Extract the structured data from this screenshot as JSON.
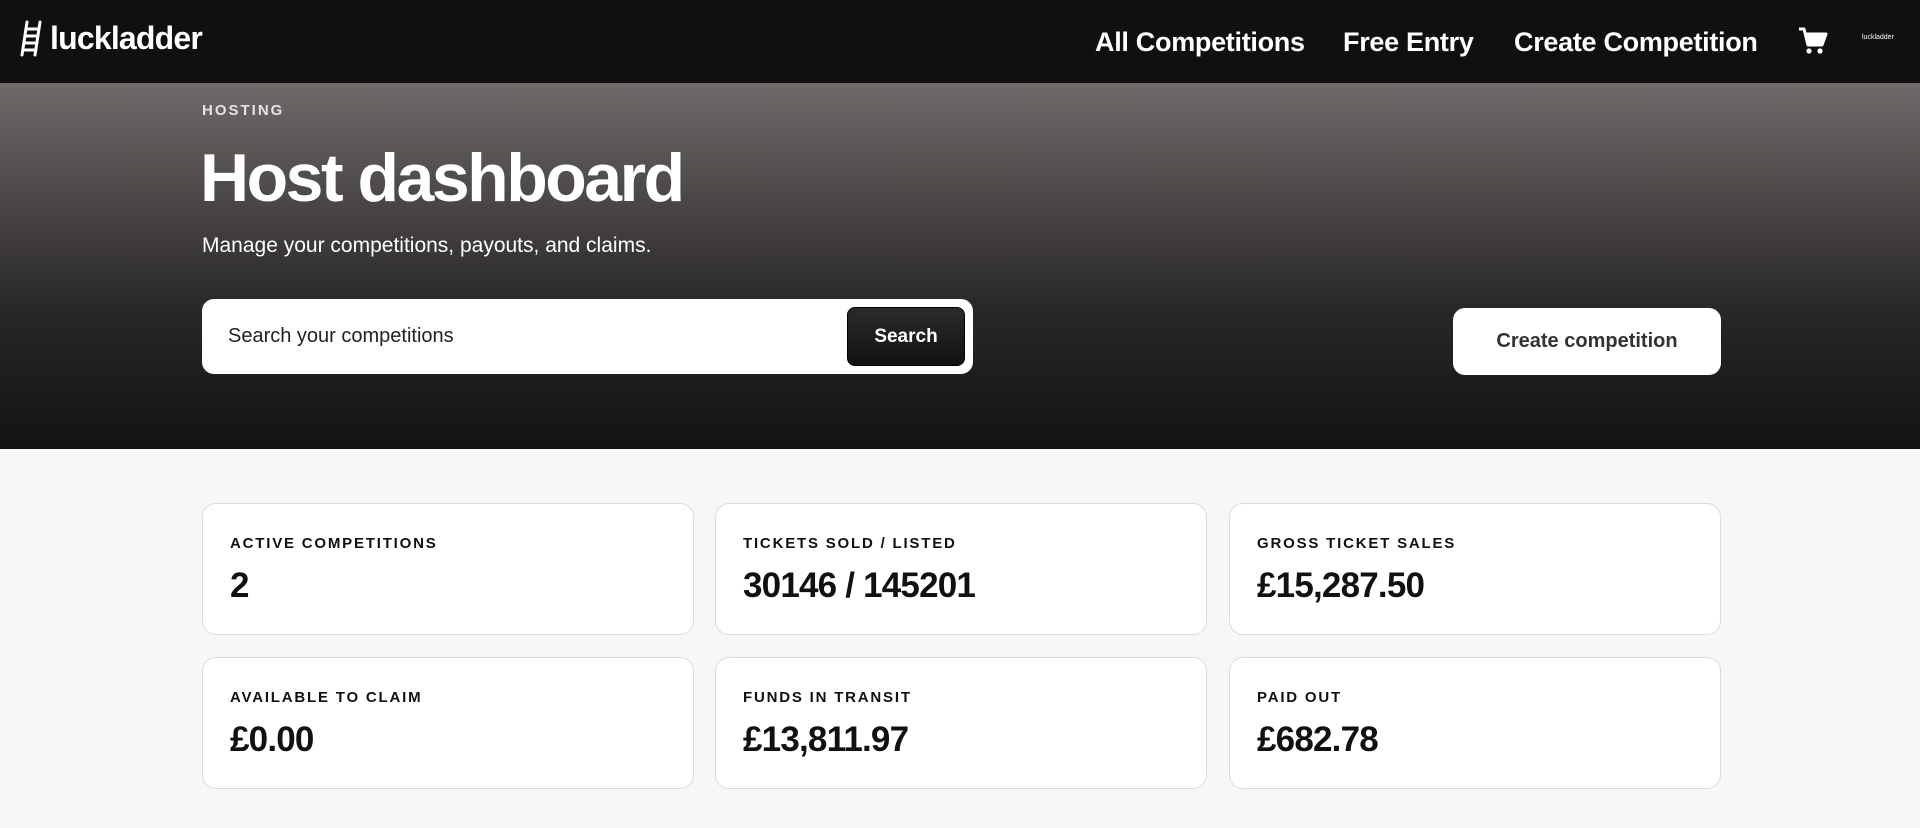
{
  "header": {
    "brand": "luckladder",
    "nav": [
      {
        "label": "All Competitions"
      },
      {
        "label": "Free Entry"
      },
      {
        "label": "Create Competition"
      }
    ],
    "cart_icon": "cart-icon",
    "mini_logo": "luckladder"
  },
  "hero": {
    "eyebrow": "HOSTING",
    "title": "Host dashboard",
    "subtitle": "Manage your competitions, payouts, and claims.",
    "search": {
      "placeholder": "Search your competitions",
      "value": "",
      "button_label": "Search"
    },
    "create_label": "Create competition"
  },
  "stats": [
    {
      "label": "ACTIVE COMPETITIONS",
      "value": "2"
    },
    {
      "label": "TICKETS SOLD / LISTED",
      "value": "30146 / 145201"
    },
    {
      "label": "GROSS TICKET SALES",
      "value": "£15,287.50"
    },
    {
      "label": "AVAILABLE TO CLAIM",
      "value": "£0.00"
    },
    {
      "label": "FUNDS IN TRANSIT",
      "value": "£13,811.97"
    },
    {
      "label": "PAID OUT",
      "value": "£682.78"
    }
  ],
  "colors": {
    "topbar": "#111010",
    "hero_top": "#6f6a69",
    "hero_bottom": "#141313",
    "page_bg": "#f8f6f6",
    "card_bg": "#ffffff"
  }
}
